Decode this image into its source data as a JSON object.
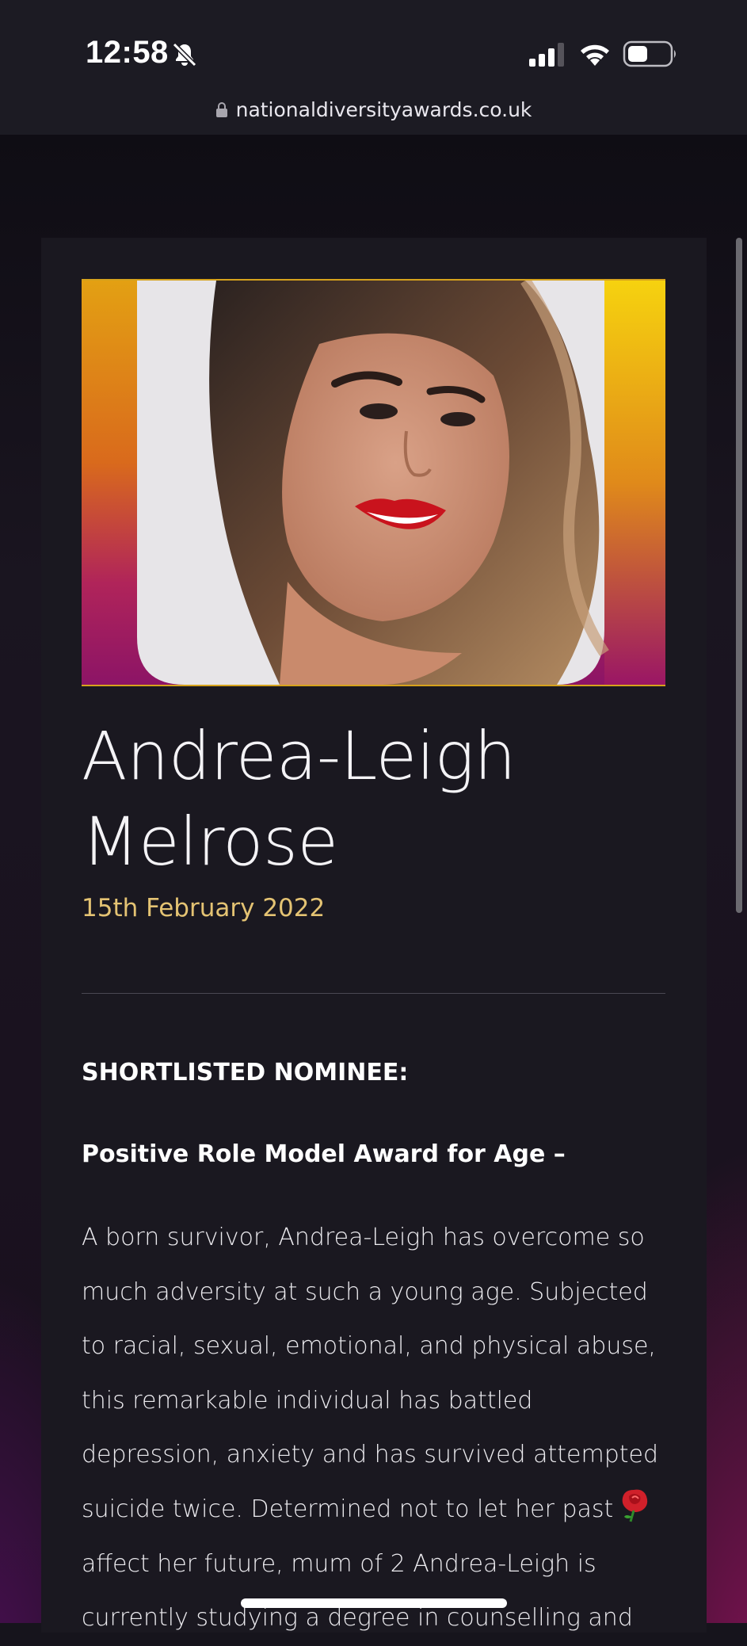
{
  "status_bar": {
    "time": "12:58",
    "icons": [
      "bell-slash-icon",
      "signal-icon",
      "wifi-icon",
      "battery-icon"
    ]
  },
  "browser": {
    "url": "nationaldiversityawards.co.uk",
    "lock_icon": "lock-icon"
  },
  "profile": {
    "name_line1": "Andrea-Leigh",
    "name_line2": "Melrose",
    "date": "15th February 2022"
  },
  "nomination": {
    "label": "SHORTLISTED NOMINEE:",
    "award": "Positive Role Model Award for Age –"
  },
  "bio": {
    "lines": [
      "A born survivor, Andrea-Leigh has overcome so",
      "much adversity at such a young age. Subjected",
      "to racial, sexual, emotional, and physical abuse,",
      "this remarkable individual has battled",
      "depression, anxiety and has survived attempted",
      "suicide twice. Determined not to let her past",
      "affect her future, mum of 2 Andrea-Leigh is",
      "currently studying a degree in counselling and"
    ],
    "emoji": "rose-icon"
  },
  "colors": {
    "accent_gold": "#e4c373",
    "card_bg": "#1a1820",
    "status_bg": "#1c1b23"
  }
}
